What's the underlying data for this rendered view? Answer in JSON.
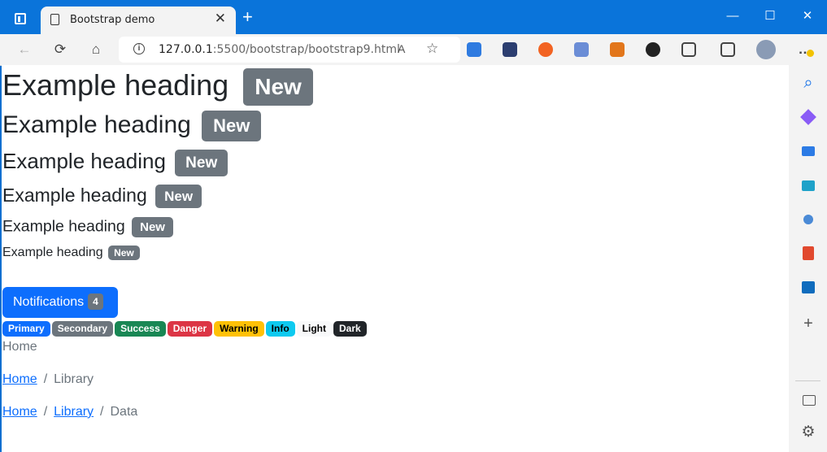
{
  "tab": {
    "title": "Bootstrap demo",
    "close_glyph": "✕",
    "new_tab_glyph": "+"
  },
  "window": {
    "minimize": "—",
    "maximize": "☐",
    "close": "✕"
  },
  "address": {
    "host": "127.0.0.1",
    "rest": ":5500/bootstrap/bootstrap9.html"
  },
  "toolbar": {
    "back": "←",
    "refresh": "⟳",
    "home": "⌂",
    "read_aloud": "A",
    "favorite": "☆",
    "more": "…"
  },
  "headings": [
    {
      "text": "Example heading",
      "badge": "New"
    },
    {
      "text": "Example heading",
      "badge": "New"
    },
    {
      "text": "Example heading",
      "badge": "New"
    },
    {
      "text": "Example heading",
      "badge": "New"
    },
    {
      "text": "Example heading",
      "badge": "New"
    },
    {
      "text": "Example heading",
      "badge": "New"
    }
  ],
  "notifications": {
    "label": "Notifications",
    "count": "4"
  },
  "badges": [
    {
      "label": "Primary",
      "color": "#0d6efd",
      "text_color": "#ffffff"
    },
    {
      "label": "Secondary",
      "color": "#6c757d",
      "text_color": "#ffffff"
    },
    {
      "label": "Success",
      "color": "#198754",
      "text_color": "#ffffff"
    },
    {
      "label": "Danger",
      "color": "#dc3545",
      "text_color": "#ffffff"
    },
    {
      "label": "Warning",
      "color": "#ffc107",
      "text_color": "#000000"
    },
    {
      "label": "Info",
      "color": "#0dcaf0",
      "text_color": "#000000"
    },
    {
      "label": "Light",
      "color": "#f8f9fa",
      "text_color": "#000000"
    },
    {
      "label": "Dark",
      "color": "#212529",
      "text_color": "#ffffff"
    }
  ],
  "breadcrumbs": [
    {
      "items": [
        "Home"
      ],
      "active": "Home"
    },
    {
      "items": [
        "Home"
      ],
      "active": "Library"
    },
    {
      "items": [
        "Home",
        "Library"
      ],
      "active": "Data"
    }
  ],
  "sidebar": {
    "search": "⌕",
    "add": "+",
    "settings": "⚙"
  }
}
